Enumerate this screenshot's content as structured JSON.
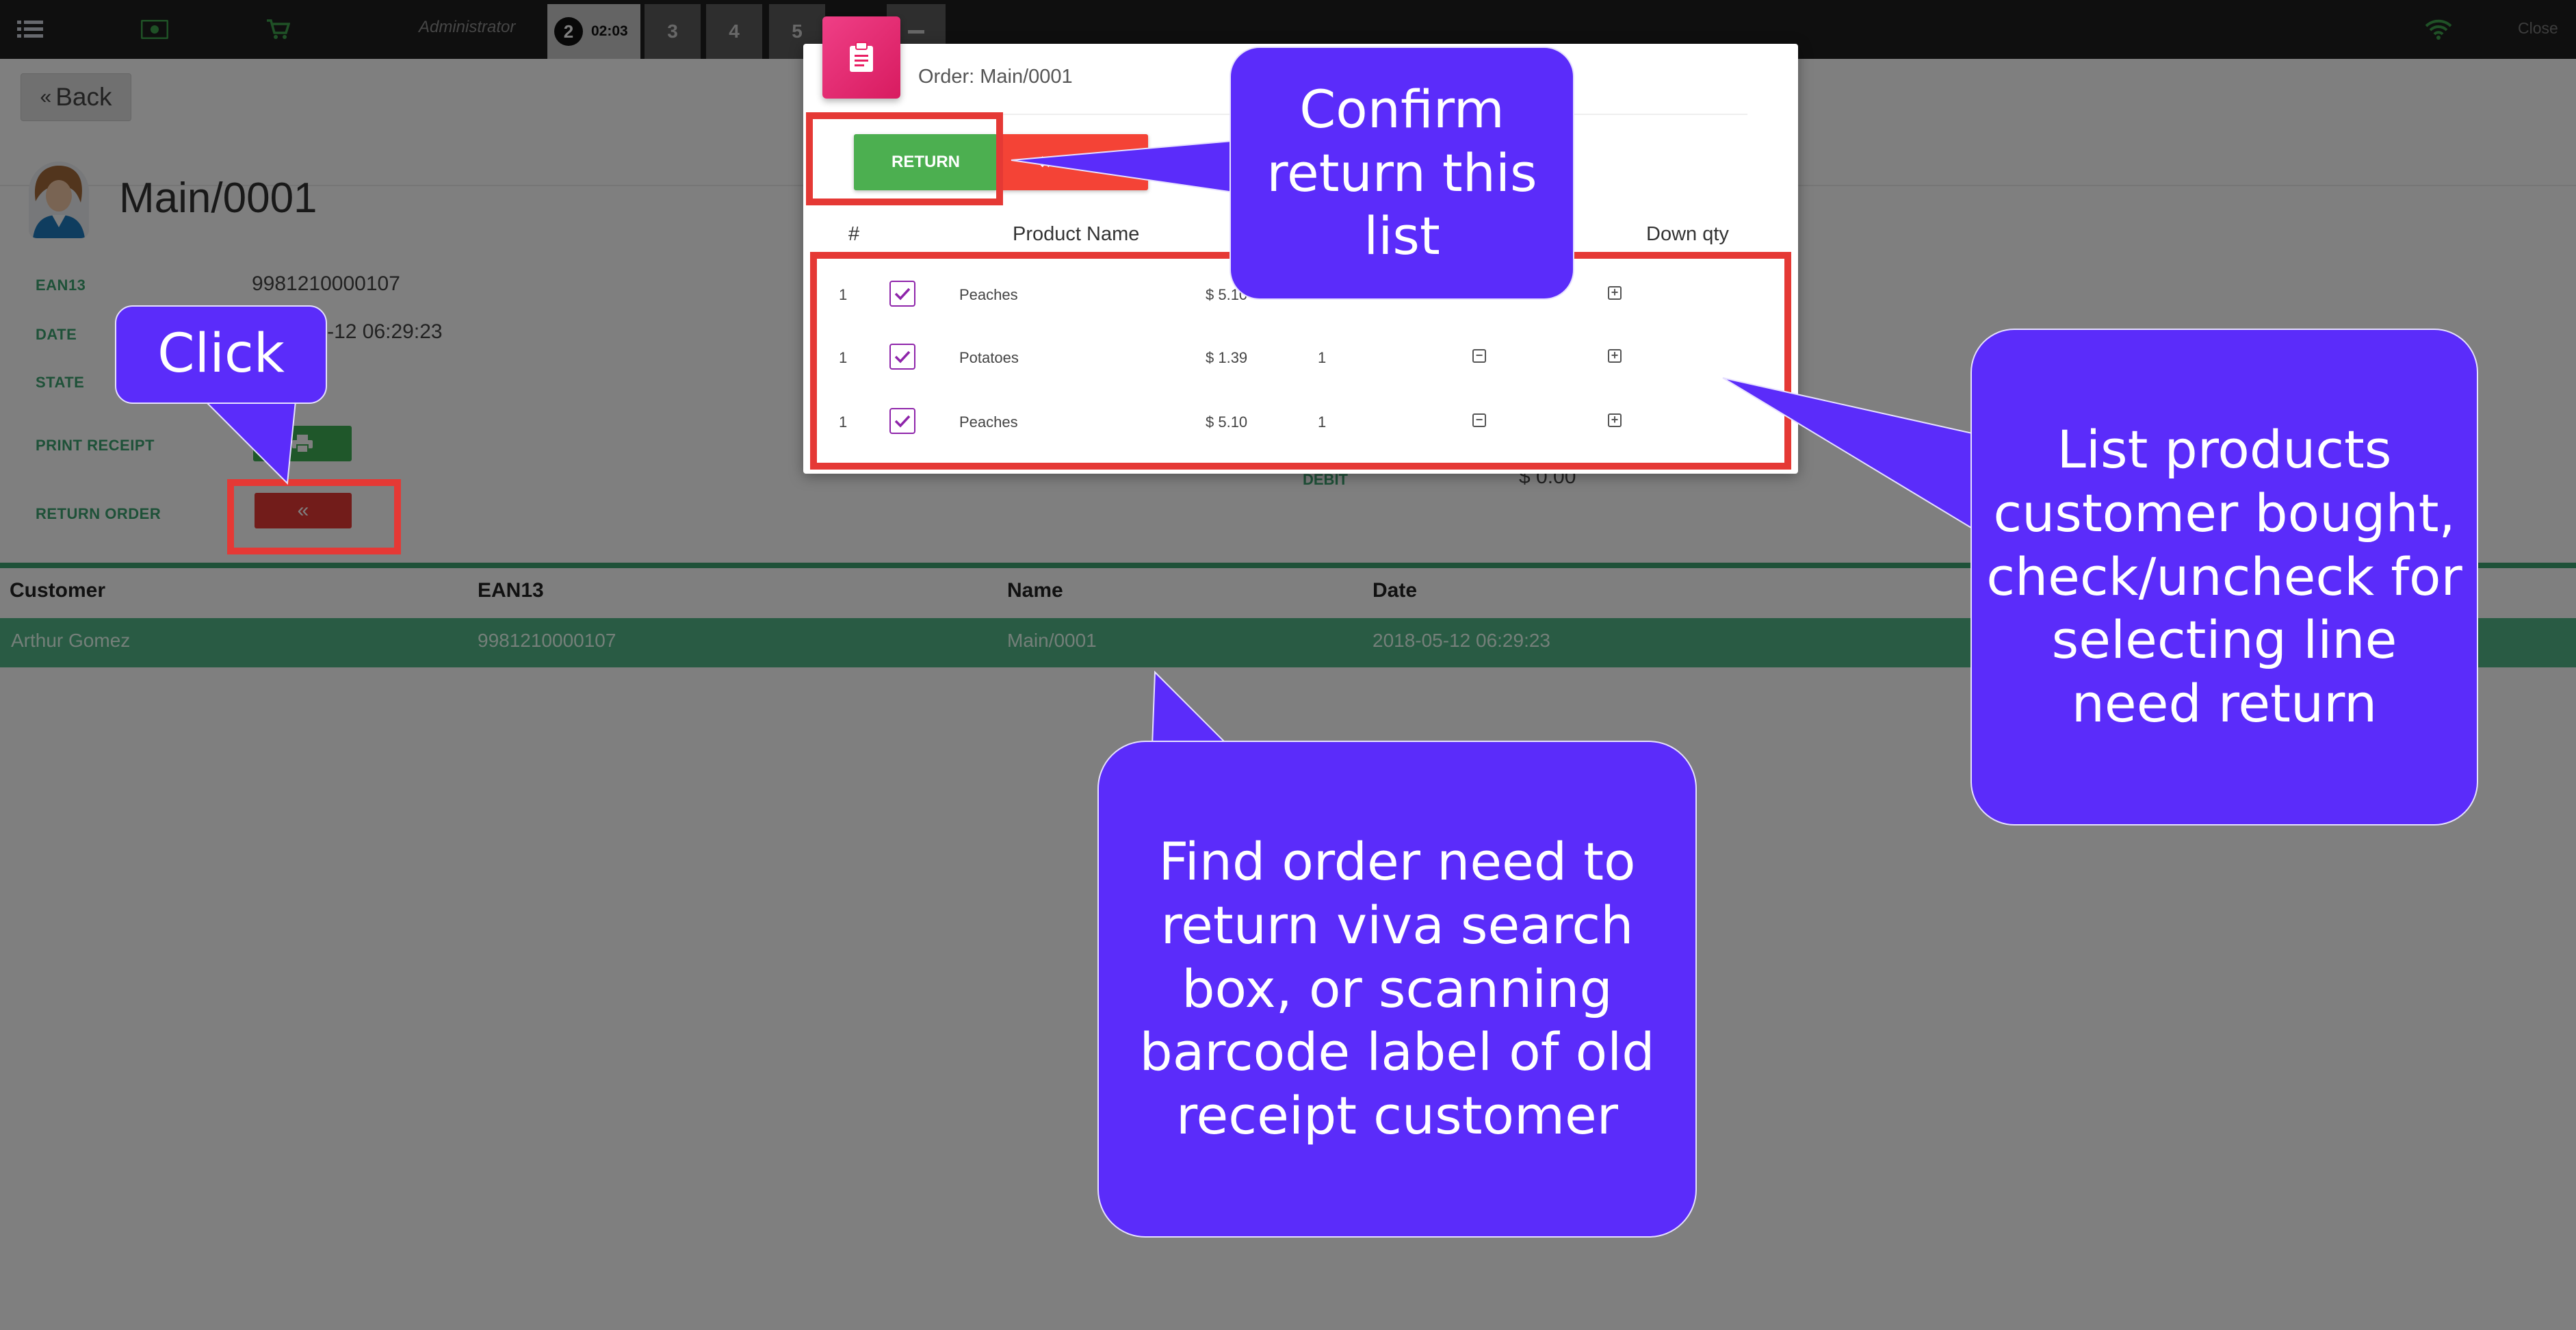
{
  "topbar": {
    "user": "Administrator",
    "tabs": [
      {
        "num": "2",
        "time": "02:03"
      },
      {
        "num": "3"
      },
      {
        "num": "4"
      },
      {
        "num": "5"
      }
    ],
    "close_label": "Close"
  },
  "back_label": "Back",
  "order": {
    "title": "Main/0001",
    "fields": {
      "ean13_label": "EAN13",
      "ean13_value": "9981210000107",
      "date_label": "DATE",
      "date_value": "2018-05-12 06:29:23",
      "state_label": "STATE",
      "print_label": "PRINT RECEIPT",
      "return_label": "RETURN ORDER",
      "debit_label": "DEBIT",
      "debit_value": "$ 0.00"
    }
  },
  "orders_table": {
    "headers": [
      "Customer",
      "EAN13",
      "Name",
      "Date"
    ],
    "rows": [
      {
        "customer": "Arthur Gomez",
        "ean13": "9981210000107",
        "name": "Main/0001",
        "date": "2018-05-12 06:29:23"
      }
    ]
  },
  "modal": {
    "title": "Order: Main/0001",
    "return_label": "RETURN",
    "close_label": "Close",
    "headers": {
      "num": "#",
      "product": "Product Name",
      "down_qty": "Down qty"
    },
    "lines": [
      {
        "num": "1",
        "product": "Peaches",
        "price": "$ 5.10",
        "qty": "1",
        "checked": true
      },
      {
        "num": "1",
        "product": "Potatoes",
        "price": "$ 1.39",
        "qty": "1",
        "checked": true
      },
      {
        "num": "1",
        "product": "Peaches",
        "price": "$ 5.10",
        "qty": "1",
        "checked": true
      }
    ]
  },
  "callouts": {
    "click": "Click",
    "confirm": [
      "Confirm",
      "return this",
      "list"
    ],
    "list": [
      "List products",
      "customer bought,",
      "check/uncheck for",
      "selecting line",
      "need return"
    ],
    "find": [
      "Find order need to",
      "return viva search",
      "box, or scanning",
      "barcode label of old",
      "receipt customer"
    ]
  },
  "colors": {
    "callout_bg": "#5b2cfa",
    "highlight_border": "#e53935",
    "accent_green": "#3ca371",
    "modal_icon": "#e91e63"
  }
}
